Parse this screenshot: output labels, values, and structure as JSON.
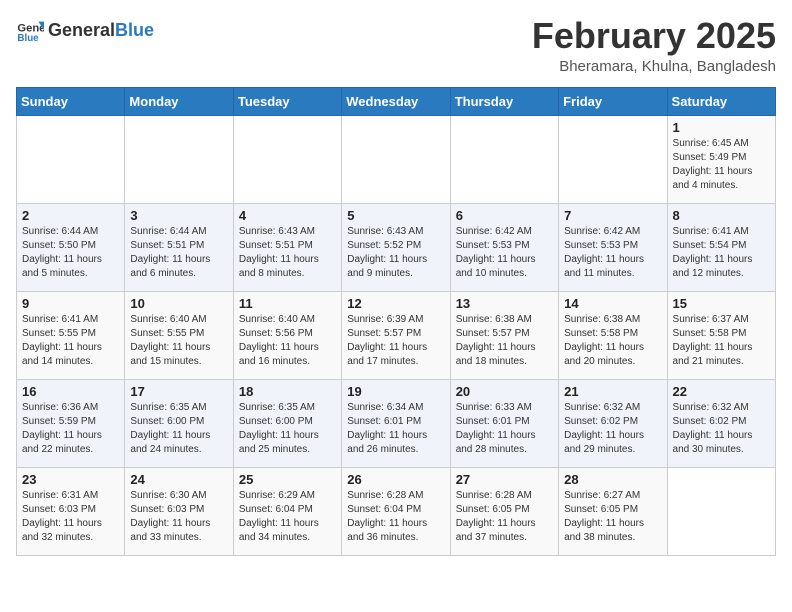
{
  "header": {
    "logo_general": "General",
    "logo_blue": "Blue",
    "month_year": "February 2025",
    "location": "Bheramara, Khulna, Bangladesh"
  },
  "weekdays": [
    "Sunday",
    "Monday",
    "Tuesday",
    "Wednesday",
    "Thursday",
    "Friday",
    "Saturday"
  ],
  "weeks": [
    [
      {
        "day": "",
        "info": ""
      },
      {
        "day": "",
        "info": ""
      },
      {
        "day": "",
        "info": ""
      },
      {
        "day": "",
        "info": ""
      },
      {
        "day": "",
        "info": ""
      },
      {
        "day": "",
        "info": ""
      },
      {
        "day": "1",
        "info": "Sunrise: 6:45 AM\nSunset: 5:49 PM\nDaylight: 11 hours and 4 minutes."
      }
    ],
    [
      {
        "day": "2",
        "info": "Sunrise: 6:44 AM\nSunset: 5:50 PM\nDaylight: 11 hours and 5 minutes."
      },
      {
        "day": "3",
        "info": "Sunrise: 6:44 AM\nSunset: 5:51 PM\nDaylight: 11 hours and 6 minutes."
      },
      {
        "day": "4",
        "info": "Sunrise: 6:43 AM\nSunset: 5:51 PM\nDaylight: 11 hours and 8 minutes."
      },
      {
        "day": "5",
        "info": "Sunrise: 6:43 AM\nSunset: 5:52 PM\nDaylight: 11 hours and 9 minutes."
      },
      {
        "day": "6",
        "info": "Sunrise: 6:42 AM\nSunset: 5:53 PM\nDaylight: 11 hours and 10 minutes."
      },
      {
        "day": "7",
        "info": "Sunrise: 6:42 AM\nSunset: 5:53 PM\nDaylight: 11 hours and 11 minutes."
      },
      {
        "day": "8",
        "info": "Sunrise: 6:41 AM\nSunset: 5:54 PM\nDaylight: 11 hours and 12 minutes."
      }
    ],
    [
      {
        "day": "9",
        "info": "Sunrise: 6:41 AM\nSunset: 5:55 PM\nDaylight: 11 hours and 14 minutes."
      },
      {
        "day": "10",
        "info": "Sunrise: 6:40 AM\nSunset: 5:55 PM\nDaylight: 11 hours and 15 minutes."
      },
      {
        "day": "11",
        "info": "Sunrise: 6:40 AM\nSunset: 5:56 PM\nDaylight: 11 hours and 16 minutes."
      },
      {
        "day": "12",
        "info": "Sunrise: 6:39 AM\nSunset: 5:57 PM\nDaylight: 11 hours and 17 minutes."
      },
      {
        "day": "13",
        "info": "Sunrise: 6:38 AM\nSunset: 5:57 PM\nDaylight: 11 hours and 18 minutes."
      },
      {
        "day": "14",
        "info": "Sunrise: 6:38 AM\nSunset: 5:58 PM\nDaylight: 11 hours and 20 minutes."
      },
      {
        "day": "15",
        "info": "Sunrise: 6:37 AM\nSunset: 5:58 PM\nDaylight: 11 hours and 21 minutes."
      }
    ],
    [
      {
        "day": "16",
        "info": "Sunrise: 6:36 AM\nSunset: 5:59 PM\nDaylight: 11 hours and 22 minutes."
      },
      {
        "day": "17",
        "info": "Sunrise: 6:35 AM\nSunset: 6:00 PM\nDaylight: 11 hours and 24 minutes."
      },
      {
        "day": "18",
        "info": "Sunrise: 6:35 AM\nSunset: 6:00 PM\nDaylight: 11 hours and 25 minutes."
      },
      {
        "day": "19",
        "info": "Sunrise: 6:34 AM\nSunset: 6:01 PM\nDaylight: 11 hours and 26 minutes."
      },
      {
        "day": "20",
        "info": "Sunrise: 6:33 AM\nSunset: 6:01 PM\nDaylight: 11 hours and 28 minutes."
      },
      {
        "day": "21",
        "info": "Sunrise: 6:32 AM\nSunset: 6:02 PM\nDaylight: 11 hours and 29 minutes."
      },
      {
        "day": "22",
        "info": "Sunrise: 6:32 AM\nSunset: 6:02 PM\nDaylight: 11 hours and 30 minutes."
      }
    ],
    [
      {
        "day": "23",
        "info": "Sunrise: 6:31 AM\nSunset: 6:03 PM\nDaylight: 11 hours and 32 minutes."
      },
      {
        "day": "24",
        "info": "Sunrise: 6:30 AM\nSunset: 6:03 PM\nDaylight: 11 hours and 33 minutes."
      },
      {
        "day": "25",
        "info": "Sunrise: 6:29 AM\nSunset: 6:04 PM\nDaylight: 11 hours and 34 minutes."
      },
      {
        "day": "26",
        "info": "Sunrise: 6:28 AM\nSunset: 6:04 PM\nDaylight: 11 hours and 36 minutes."
      },
      {
        "day": "27",
        "info": "Sunrise: 6:28 AM\nSunset: 6:05 PM\nDaylight: 11 hours and 37 minutes."
      },
      {
        "day": "28",
        "info": "Sunrise: 6:27 AM\nSunset: 6:05 PM\nDaylight: 11 hours and 38 minutes."
      },
      {
        "day": "",
        "info": ""
      }
    ]
  ]
}
